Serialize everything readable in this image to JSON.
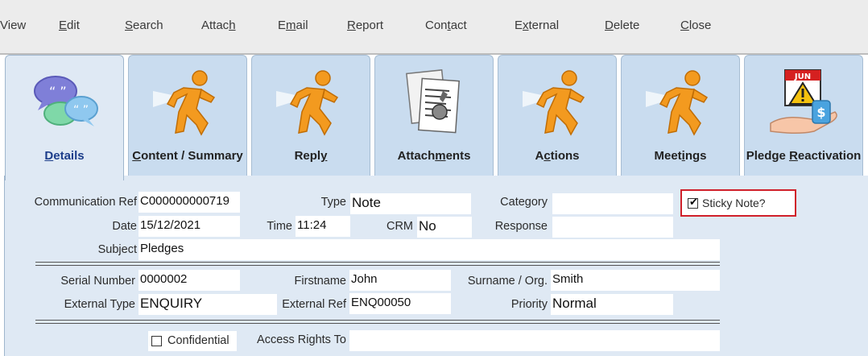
{
  "menu": {
    "view": {
      "pre": "",
      "ul": "",
      "post": "View"
    },
    "edit": {
      "pre": "",
      "ul": "E",
      "post": "dit"
    },
    "search": {
      "pre": "",
      "ul": "S",
      "post": "earch"
    },
    "attach": {
      "pre": "Attac",
      "ul": "h",
      "post": ""
    },
    "email": {
      "pre": "E",
      "ul": "m",
      "post": "ail"
    },
    "report": {
      "pre": "",
      "ul": "R",
      "post": "eport"
    },
    "contact": {
      "pre": "Con",
      "ul": "t",
      "post": "act"
    },
    "external": {
      "pre": "E",
      "ul": "x",
      "post": "ternal"
    },
    "delete": {
      "pre": "",
      "ul": "D",
      "post": "elete"
    },
    "close": {
      "pre": "",
      "ul": "C",
      "post": "lose"
    }
  },
  "tabs": {
    "details": {
      "pre": "",
      "ul": "D",
      "post": "etails",
      "icon": "speech-bubbles-icon"
    },
    "content": {
      "pre": "",
      "ul": "C",
      "post": "ontent / Summary",
      "icon": "running-man-icon"
    },
    "reply": {
      "pre": "Repl",
      "ul": "y",
      "post": "",
      "icon": "running-man-icon"
    },
    "attachments": {
      "pre": "Attach",
      "ul": "m",
      "post": "ents",
      "icon": "documents-paperclip-icon"
    },
    "actions": {
      "pre": "A",
      "ul": "c",
      "post": "tions",
      "icon": "running-man-icon"
    },
    "meetings": {
      "pre": "Meet",
      "ul": "i",
      "post": "ngs",
      "icon": "running-man-icon"
    },
    "pledge": {
      "pre": "Pledge ",
      "ul": "R",
      "post": "eactivation",
      "icon": "calendar-warning-hand-icon",
      "calendar_month": "JUN"
    }
  },
  "form": {
    "comm_ref": {
      "label": "Communication Ref",
      "value": "C000000000719"
    },
    "type": {
      "label": "Type",
      "value": "Note"
    },
    "category": {
      "label": "Category",
      "value": ""
    },
    "sticky": {
      "label": "Sticky Note?",
      "checked": true
    },
    "date": {
      "label": "Date",
      "value": "15/12/2021"
    },
    "time": {
      "label": "Time",
      "value": "11:24"
    },
    "crm": {
      "label": "CRM",
      "value": "No"
    },
    "response": {
      "label": "Response",
      "value": ""
    },
    "subject": {
      "label": "Subject",
      "value": "Pledges"
    },
    "serial": {
      "label": "Serial Number",
      "value": "0000002"
    },
    "firstname": {
      "label": "Firstname",
      "value": "John"
    },
    "surname": {
      "label": "Surname / Org.",
      "value": "Smith"
    },
    "ext_type": {
      "label": "External Type",
      "value": "ENQUIRY"
    },
    "ext_ref": {
      "label": "External Ref",
      "value": "ENQ00050"
    },
    "priority": {
      "label": "Priority",
      "value": "Normal"
    },
    "confidential": {
      "label": "Confidential",
      "checked": false
    },
    "access_rights": {
      "label": "Access Rights To",
      "value": ""
    }
  },
  "colors": {
    "sticky_highlight": "#d0202a",
    "panel": "#dfe9f4",
    "tab": "#c9dcef"
  }
}
